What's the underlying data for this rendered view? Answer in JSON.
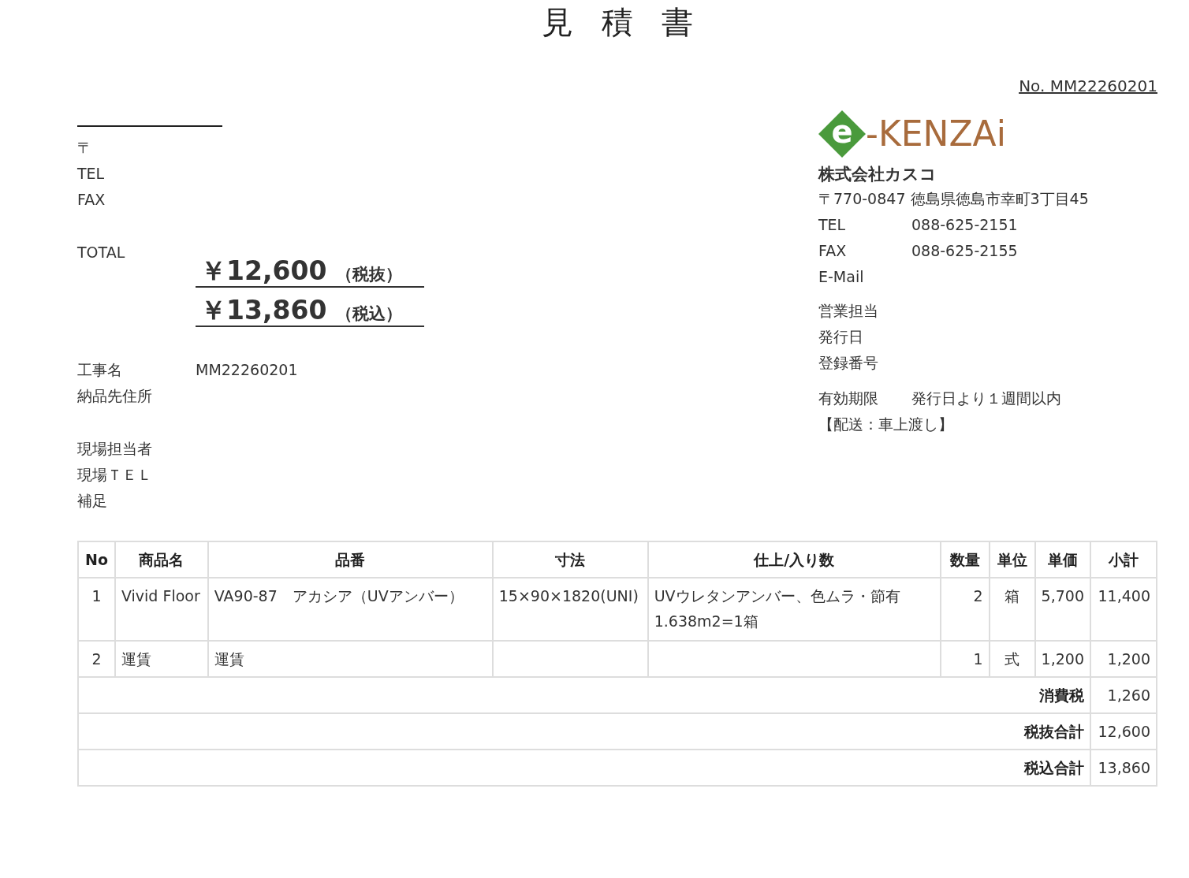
{
  "title": "見積書",
  "doc_no": "No. MM22260201",
  "customer": {
    "fields": [
      {
        "label": "〒"
      },
      {
        "label": "TEL"
      },
      {
        "label": "FAX"
      }
    ]
  },
  "total": {
    "label": "TOTAL",
    "amounts": [
      {
        "value": "￥12,600",
        "note": "（税抜）"
      },
      {
        "value": "￥13,860",
        "note": "（税込）"
      }
    ]
  },
  "project": [
    [
      {
        "label": "工事名",
        "value": "MM22260201"
      },
      {
        "label": "納品先住所"
      }
    ],
    [
      {
        "label": "現場担当者"
      },
      {
        "label": "現場ＴＥＬ"
      },
      {
        "label": "補足"
      }
    ]
  ],
  "issuer": {
    "logo": {
      "mark": "e",
      "text": "-KENZAi"
    },
    "company": "株式会社カスコ",
    "address": "〒770-0847 徳島県徳島市幸町3丁目45",
    "groups": [
      [
        {
          "label": "TEL",
          "value": "088-625-2151"
        },
        {
          "label": "FAX",
          "value": "088-625-2155"
        },
        {
          "label": "E-Mail"
        }
      ],
      [
        {
          "label": "営業担当"
        },
        {
          "label": "発行日"
        },
        {
          "label": "登録番号"
        }
      ]
    ],
    "validity": {
      "label": "有効期限",
      "value": "発行日より１週間以内"
    },
    "delivery": "【配送：車上渡し】"
  },
  "table": {
    "columns": [
      "No",
      "商品名",
      "品番",
      "寸法",
      "仕上/入り数",
      "数量",
      "単位",
      "単価",
      "小計"
    ],
    "rows": [
      {
        "cells": [
          [
            "1"
          ],
          [
            "Vivid Floor"
          ],
          [
            "VA90-87　アカシア（UVアンバー）"
          ],
          [
            "15×90×1820(UNI)"
          ],
          [
            "UVウレタンアンバー、色ムラ・節有",
            "1.638m2=1箱"
          ],
          [
            "2"
          ],
          [
            "箱"
          ],
          [
            "5,700"
          ],
          [
            "11,400"
          ]
        ]
      },
      {
        "cells": [
          [
            "2"
          ],
          [
            "運賃"
          ],
          [
            "運賃"
          ],
          [],
          [],
          [
            "1"
          ],
          [
            "式"
          ],
          [
            "1,200"
          ],
          [
            "1,200"
          ]
        ]
      }
    ],
    "summary": [
      {
        "label": "消費税",
        "value": "1,260"
      },
      {
        "label": "税抜合計",
        "value": "12,600"
      },
      {
        "label": "税込合計",
        "value": "13,860"
      }
    ]
  }
}
